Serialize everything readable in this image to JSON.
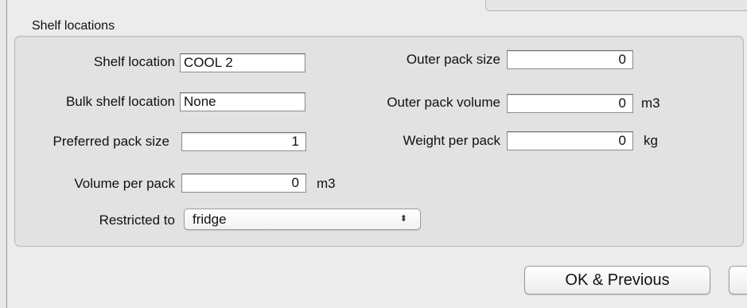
{
  "group": {
    "title": "Shelf locations"
  },
  "fields": {
    "shelf_location": {
      "label": "Shelf location",
      "value": "COOL 2"
    },
    "bulk_shelf_location": {
      "label": "Bulk shelf location",
      "value": "None"
    },
    "preferred_pack_size": {
      "label": "Preferred pack size",
      "value": "1"
    },
    "volume_per_pack": {
      "label": "Volume per pack",
      "value": "0",
      "unit": "m3"
    },
    "outer_pack_size": {
      "label": "Outer pack size",
      "value": "0"
    },
    "outer_pack_volume": {
      "label": "Outer pack volume",
      "value": "0",
      "unit": "m3"
    },
    "weight_per_pack": {
      "label": "Weight per pack",
      "value": "0",
      "unit": "kg"
    }
  },
  "restricted": {
    "label": "Restricted to",
    "selected": "fridge",
    "arrow_glyph": "⬍"
  },
  "buttons": {
    "ok_previous": "OK & Previous",
    "next": ""
  },
  "icons": {
    "select_arrows": "select-arrows-icon"
  }
}
